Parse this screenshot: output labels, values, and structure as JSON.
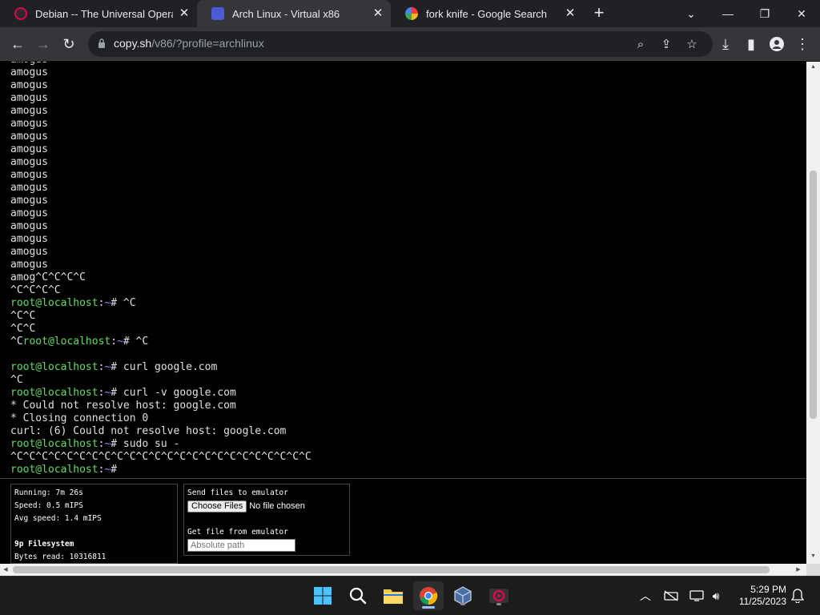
{
  "browser": {
    "tabs": [
      {
        "title": "Debian -- The Universal Operatin",
        "active": false
      },
      {
        "title": "Arch Linux - Virtual x86",
        "active": true
      },
      {
        "title": "fork knife - Google Search",
        "active": false
      }
    ],
    "url_host": "copy.sh",
    "url_path": "/v86/?profile=archlinux",
    "accent": "#35363a"
  },
  "terminal": {
    "prompt_user": "root@localhost",
    "lines": [
      {
        "text": "amogus"
      },
      {
        "text": "amogus"
      },
      {
        "text": "amogus"
      },
      {
        "text": "amogus"
      },
      {
        "text": "amogus"
      },
      {
        "text": "amogus"
      },
      {
        "text": "amogus"
      },
      {
        "text": "amogus"
      },
      {
        "text": "amogus"
      },
      {
        "text": "amogus"
      },
      {
        "text": "amogus"
      },
      {
        "text": "amogus"
      },
      {
        "text": "amogus"
      },
      {
        "text": "amogus"
      },
      {
        "text": "amogus"
      },
      {
        "text": "amogus"
      },
      {
        "text": "amogus"
      },
      {
        "text": "amog^C^C^C^C"
      },
      {
        "text": "^C^C^C^C"
      },
      {
        "prefix": "",
        "prompt": "root@localhost",
        "cmd": "# ^C"
      },
      {
        "text": "^C^C"
      },
      {
        "text": "^C^C"
      },
      {
        "prefix": "^C",
        "prompt": "root@localhost",
        "cmd": "# ^C"
      },
      {
        "text": ""
      },
      {
        "prefix": "",
        "prompt": "root@localhost",
        "cmd": "# curl google.com"
      },
      {
        "text": "^C"
      },
      {
        "prefix": "",
        "prompt": "root@localhost",
        "cmd": "# curl -v google.com"
      },
      {
        "text": "* Could not resolve host: google.com"
      },
      {
        "text": "* Closing connection 0"
      },
      {
        "text": "curl: (6) Could not resolve host: google.com"
      },
      {
        "prefix": "",
        "prompt": "root@localhost",
        "cmd": "# sudo su -"
      },
      {
        "text": "^C^C^C^C^C^C^C^C^C^C^C^C^C^C^C^C^C^C^C^C^C^C^C^C"
      },
      {
        "prefix": "",
        "prompt": "root@localhost",
        "cmd": "# "
      }
    ]
  },
  "stats": {
    "running": "Running: 7m 26s",
    "speed": "Speed: 0.5 mIPS",
    "avg_speed": "Avg speed: 1.4 mIPS",
    "fs_title": "9p Filesystem",
    "bytes_read": "Bytes read: 10316811"
  },
  "files": {
    "send_label": "Send files to emulator",
    "choose_label": "Choose Files",
    "no_file": "No file chosen",
    "get_label": "Get file from emulator",
    "path_placeholder": "Absolute path"
  },
  "taskbar": {
    "time": "5:29 PM",
    "date": "11/25/2023"
  }
}
